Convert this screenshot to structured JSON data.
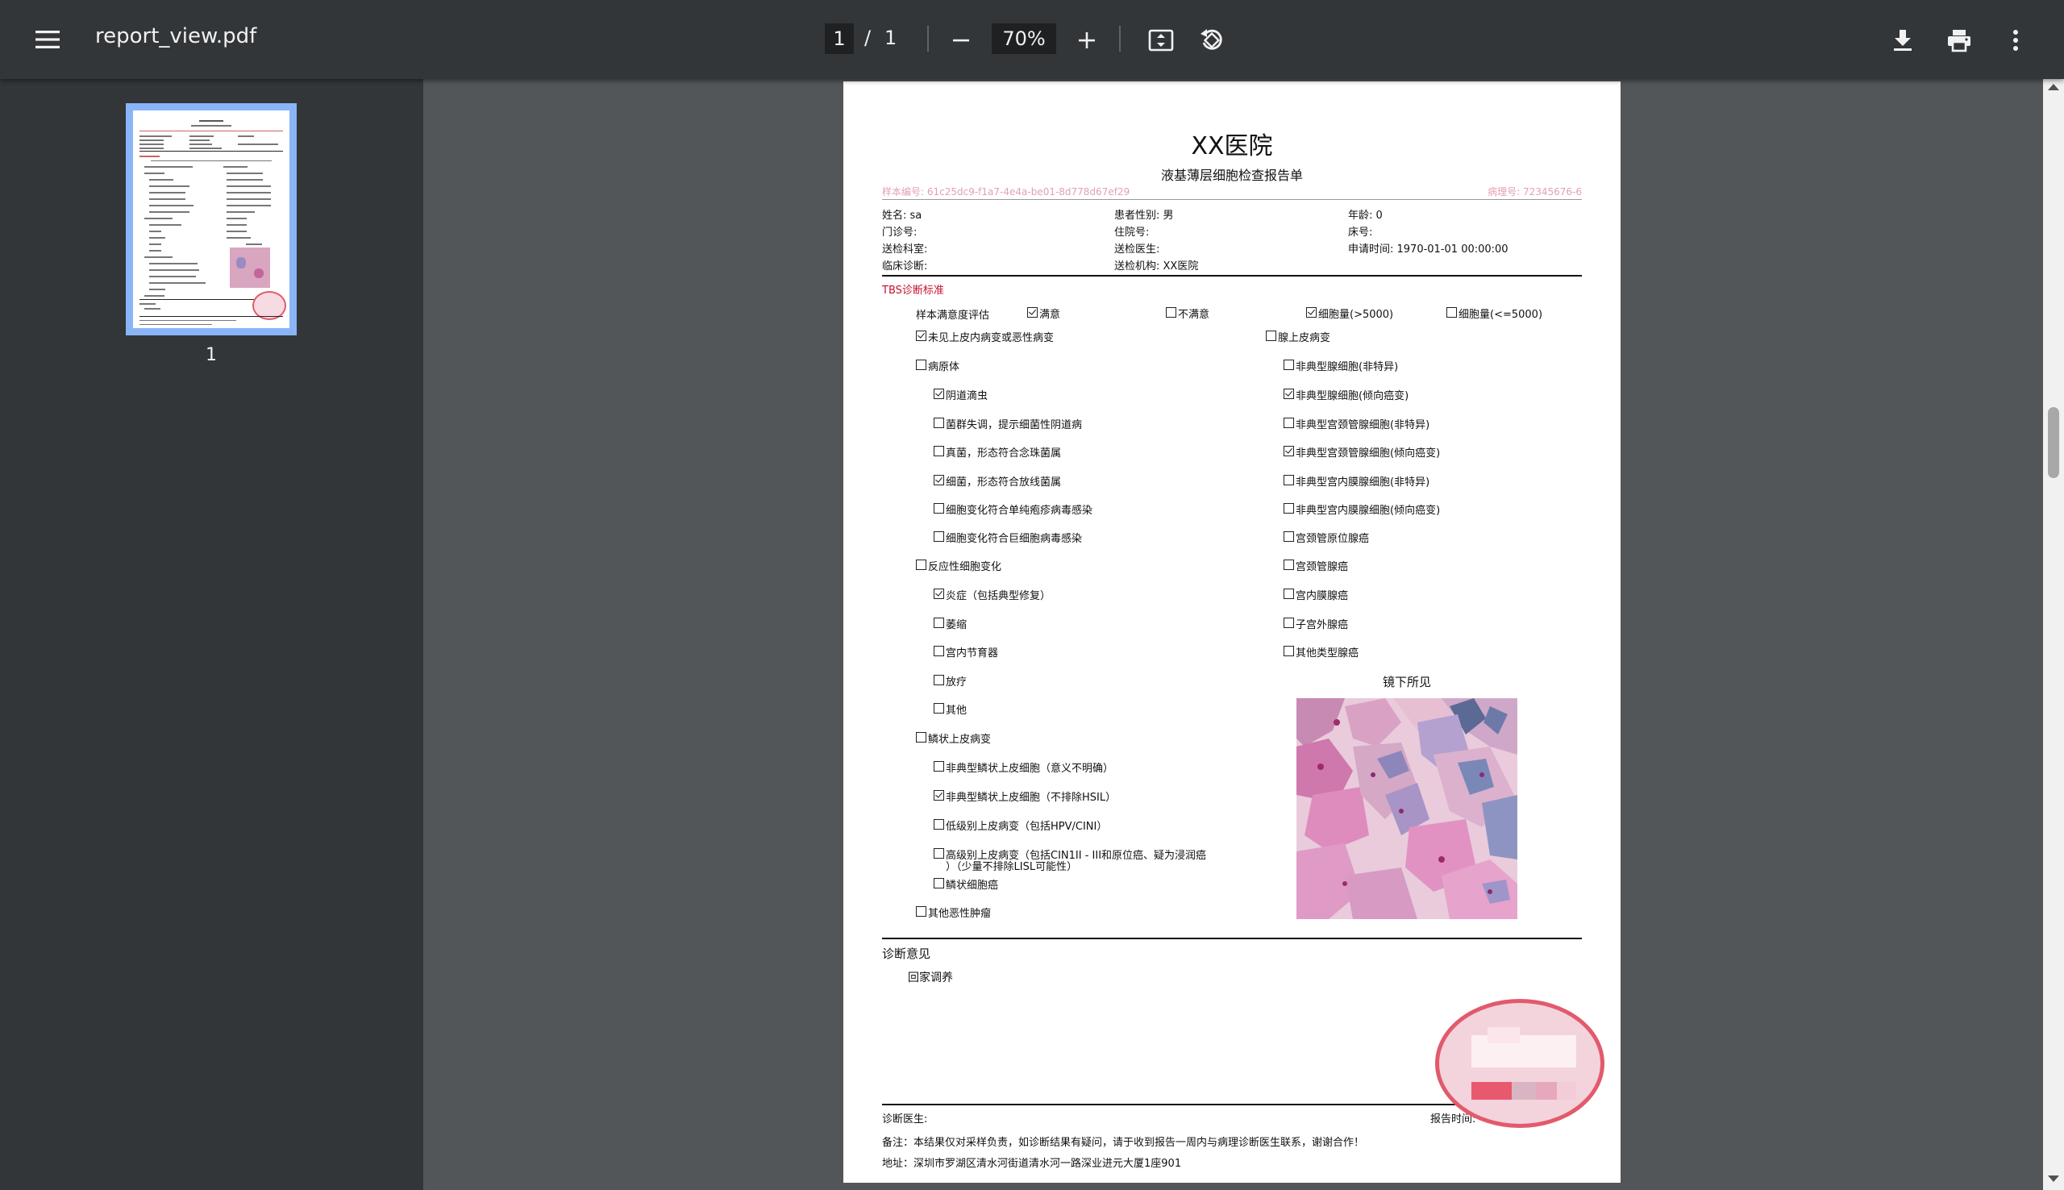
{
  "toolbar": {
    "title": "report_view.pdf",
    "current_page": "1",
    "page_separator": "/",
    "total_pages": "1",
    "zoom": "70%"
  },
  "sidebar": {
    "thumb_page_number": "1"
  },
  "report": {
    "hospital": "XX医院",
    "title": "液基薄层细胞检查报告单",
    "sample_no": "样本编号: 61c25dc9-f1a7-4e4a-be01-8d778d67ef29",
    "pathology_no": "病理号: 72345676-6",
    "info": {
      "name": "姓名: sa",
      "gender": "患者性别: 男",
      "age": "年龄: 0",
      "outpatient": "门诊号:",
      "inpatient": "住院号:",
      "bed": "床号:",
      "dept": "送检科室:",
      "doctor": "送检医生:",
      "apply_time": "申请时间: 1970-01-01 00:00:00",
      "clinical": "临床诊断:",
      "institution": "送检机构: XX医院"
    },
    "tbs_title": "TBS诊断标准",
    "satisfaction_label": "样本满意度评估",
    "satisfaction": [
      {
        "label": "满意",
        "checked": true
      },
      {
        "label": "不满意",
        "checked": false
      },
      {
        "label": "细胞量(>5000)",
        "checked": true
      },
      {
        "label": "细胞量(<=5000)",
        "checked": false
      }
    ],
    "left_items": [
      {
        "label": "未见上皮内病变或恶性病变",
        "checked": true
      },
      {
        "label": "病原体",
        "checked": false
      },
      {
        "label": "阴道滴虫",
        "checked": true
      },
      {
        "label": "菌群失调，提示细菌性阴道病",
        "checked": false
      },
      {
        "label": "真菌，形态符合念珠菌属",
        "checked": false
      },
      {
        "label": "细菌，形态符合放线菌属",
        "checked": true
      },
      {
        "label": "细胞变化符合单纯疱疹病毒感染",
        "checked": false
      },
      {
        "label": "细胞变化符合巨细胞病毒感染",
        "checked": false
      },
      {
        "label": "反应性细胞变化",
        "checked": false
      },
      {
        "label": "炎症（包括典型修复）",
        "checked": true
      },
      {
        "label": "萎缩",
        "checked": false
      },
      {
        "label": "宫内节育器",
        "checked": false
      },
      {
        "label": "放疗",
        "checked": false
      },
      {
        "label": "其他",
        "checked": false
      },
      {
        "label": "鳞状上皮病变",
        "checked": false
      },
      {
        "label": "非典型鳞状上皮细胞（意义不明确）",
        "checked": false
      },
      {
        "label": "非典型鳞状上皮细胞（不排除HSIL）",
        "checked": true
      },
      {
        "label": "低级别上皮病变（包括HPV/CINI）",
        "checked": false
      },
      {
        "label": "高级别上皮病变（包括CIN1II - III和原位癌、疑为浸润癌",
        "label2": "）（少量不排除LISL可能性）",
        "checked": false
      },
      {
        "label": "鳞状细胞癌",
        "checked": false
      },
      {
        "label": "其他恶性肿瘤",
        "checked": false
      }
    ],
    "right_items": [
      {
        "label": "腺上皮病变",
        "checked": false
      },
      {
        "label": "非典型腺细胞(非特异)",
        "checked": false
      },
      {
        "label": "非典型腺细胞(倾向癌变)",
        "checked": true
      },
      {
        "label": "非典型宫颈管腺细胞(非特异)",
        "checked": false
      },
      {
        "label": "非典型宫颈管腺细胞(倾向癌变)",
        "checked": true
      },
      {
        "label": "非典型宫内膜腺细胞(非特异)",
        "checked": false
      },
      {
        "label": "非典型宫内膜腺细胞(倾向癌变)",
        "checked": false
      },
      {
        "label": "宫颈管原位腺癌",
        "checked": false
      },
      {
        "label": "宫颈管腺癌",
        "checked": false
      },
      {
        "label": "宫内膜腺癌",
        "checked": false
      },
      {
        "label": "子宫外腺癌",
        "checked": false
      },
      {
        "label": "其他类型腺癌",
        "checked": false
      }
    ],
    "micro_title": "镜下所见",
    "diag_title": "诊断意见",
    "diag_text": "回家调养",
    "diag_doctor": "诊断医生:",
    "report_time": "报告时间:",
    "note": "备注：本结果仅对采样负责，如诊断结果有疑问，请于收到报告一周内与病理诊断医生联系，谢谢合作！",
    "address": "地址：深圳市罗湖区清水河街道清水河一路深业进元大厦1座901"
  },
  "colors": {
    "accent": "#c8102e",
    "thumb_highlight": "#8ab4f8",
    "toolbar_bg": "#323639"
  }
}
